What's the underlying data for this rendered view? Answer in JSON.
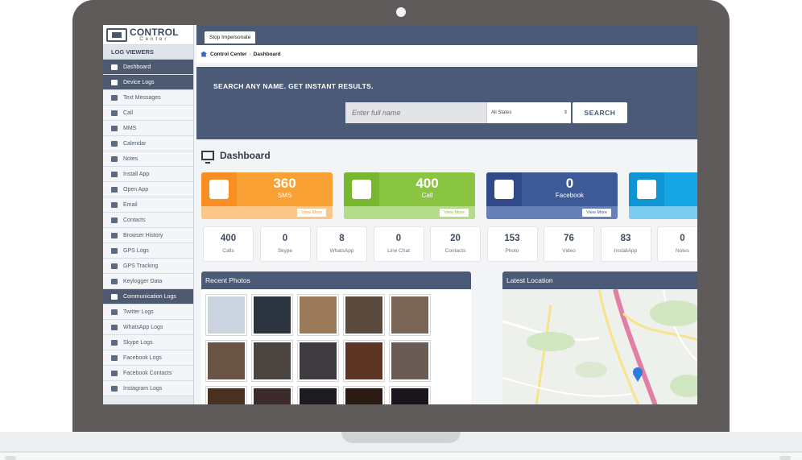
{
  "app": {
    "logo_main": "CONTROL",
    "logo_sub": "Center"
  },
  "sidebar": {
    "section_log_viewers": "LOG VIEWERS",
    "items": [
      {
        "label": "Dashboard",
        "head": true
      },
      {
        "label": "Device Logs",
        "head": true
      },
      {
        "label": "Text Messages"
      },
      {
        "label": "Call"
      },
      {
        "label": "MMS"
      },
      {
        "label": "Calendar"
      },
      {
        "label": "Notes"
      },
      {
        "label": "Install App"
      },
      {
        "label": "Open App"
      },
      {
        "label": "Email"
      },
      {
        "label": "Contacts"
      },
      {
        "label": "Browser History"
      },
      {
        "label": "GPS Logs"
      },
      {
        "label": "GPS Tracking"
      },
      {
        "label": "Keylogger Data"
      },
      {
        "label": "Communication Logs",
        "head": true
      },
      {
        "label": "Twitter Logs"
      },
      {
        "label": "WhatsApp Logs"
      },
      {
        "label": "Skype Logs"
      },
      {
        "label": "Facebook Logs"
      },
      {
        "label": "Facebook Contacts"
      },
      {
        "label": "Instagram Logs"
      }
    ]
  },
  "topbar": {
    "stop_impersonate": "Stop Impersonate"
  },
  "breadcrumb": {
    "root": "Control Center",
    "current": "Dashboard"
  },
  "search": {
    "title": "SEARCH ANY NAME. GET INSTANT RESULTS.",
    "placeholder": "Enter full name",
    "state_value": "All States",
    "button": "SEARCH"
  },
  "dashboard": {
    "title": "Dashboard"
  },
  "cards": [
    {
      "value": "360",
      "label": "SMS",
      "view_more": "View More",
      "color": "#f9a134",
      "icon_bg": "#f98f23",
      "foot": "#fbc788",
      "icon": "envelope-icon"
    },
    {
      "value": "400",
      "label": "Call",
      "view_more": "View More",
      "color": "#89c540",
      "icon_bg": "#76b72f",
      "foot": "#b5dc8b",
      "icon": "phone-icon"
    },
    {
      "value": "0",
      "label": "Facebook",
      "view_more": "View More",
      "color": "#3c5a98",
      "icon_bg": "#2f4a86",
      "foot": "#6781b8",
      "icon": "facebook-icon"
    },
    {
      "value": "",
      "label": "",
      "view_more": "",
      "color": "#16a6e6",
      "icon_bg": "#0f95d4",
      "foot": "#7dcdf2",
      "icon": "skype-icon"
    }
  ],
  "counters": [
    {
      "value": "400",
      "label": "Calls"
    },
    {
      "value": "0",
      "label": "Skype"
    },
    {
      "value": "8",
      "label": "WhatsApp"
    },
    {
      "value": "0",
      "label": "Line Chat"
    },
    {
      "value": "20",
      "label": "Contacts"
    },
    {
      "value": "153",
      "label": "Photo"
    },
    {
      "value": "76",
      "label": "Video"
    },
    {
      "value": "83",
      "label": "InstallApp"
    },
    {
      "value": "0",
      "label": "Notes"
    }
  ],
  "panels": {
    "recent_photos": "Recent Photos",
    "latest_location": "Latest Location"
  },
  "photo_colors": [
    "#c9d4df",
    "#2c3440",
    "#9b7a5a",
    "#5a4a3e",
    "#7a6456",
    "#6a5446",
    "#4a4440",
    "#3e3a40",
    "#5c3424",
    "#6a5c54",
    "#4a3020",
    "#3a2a2a",
    "#1e1a22",
    "#2a1a12",
    "#1a141c"
  ],
  "colors": {
    "accent": "#4b5a77",
    "sidebar_head": "#4d5a70"
  }
}
